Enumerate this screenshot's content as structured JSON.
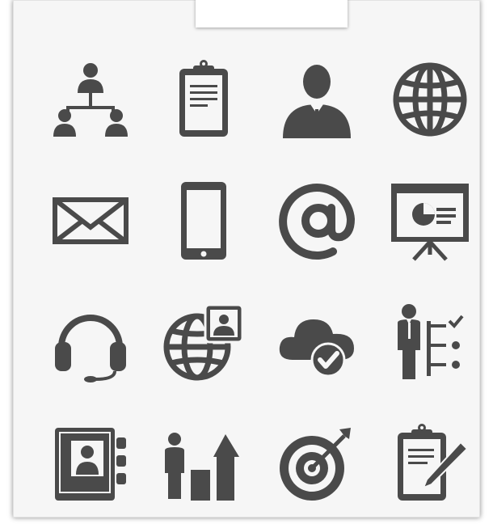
{
  "colors": {
    "icon": "#4a4a4a",
    "page": "#f6f6f6",
    "tab": "#ffffff"
  },
  "icons": [
    "org-chart-icon",
    "clipboard-icon",
    "businessman-icon",
    "globe-icon",
    "envelope-icon",
    "smartphone-icon",
    "at-sign-icon",
    "presentation-board-icon",
    "headset-icon",
    "global-contact-icon",
    "cloud-check-icon",
    "businessman-checklist-icon",
    "address-book-icon",
    "growth-chart-icon",
    "target-arrow-icon",
    "clipboard-edit-icon"
  ]
}
